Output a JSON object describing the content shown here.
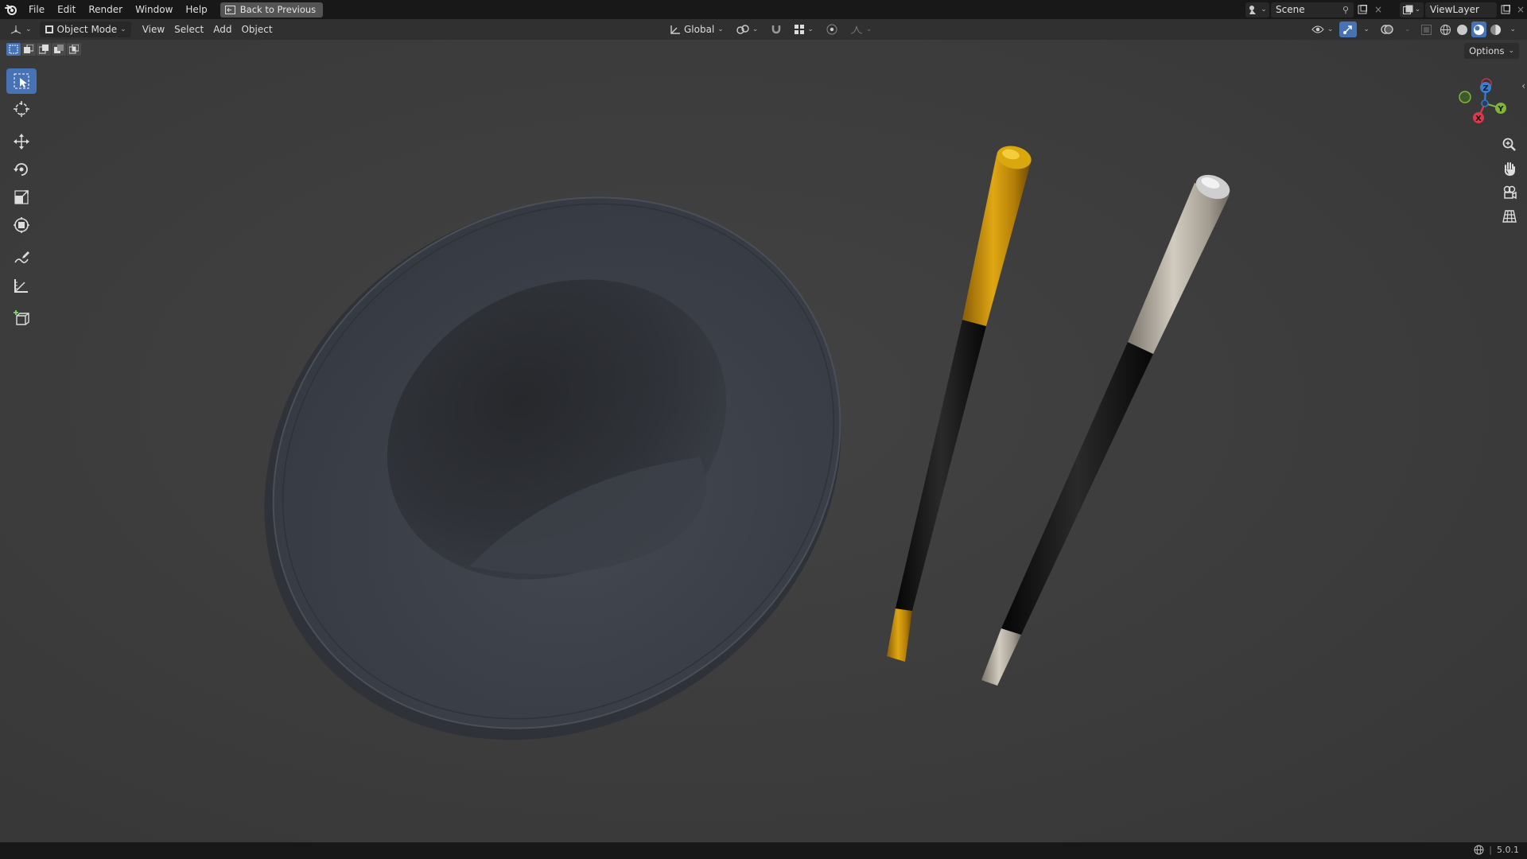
{
  "menubar": {
    "items": [
      "File",
      "Edit",
      "Render",
      "Window",
      "Help"
    ],
    "back_button": "Back to Previous",
    "scene_name": "Scene",
    "view_layer": "ViewLayer"
  },
  "header": {
    "mode": "Object Mode",
    "menus": [
      "View",
      "Select",
      "Add",
      "Object"
    ],
    "orientation": "Global"
  },
  "viewport": {
    "options_label": "Options",
    "gizmo_axes": {
      "x": "X",
      "y": "Y",
      "z": "Z"
    }
  },
  "toolbar": {
    "tools": [
      "select-box",
      "cursor",
      "move",
      "rotate",
      "scale",
      "transform",
      "annotate",
      "measure",
      "add-cube"
    ],
    "active_tool": "select-box"
  },
  "statusbar": {
    "version": "5.0.1"
  },
  "colors": {
    "accent": "#4772b3",
    "gold": "#c89210",
    "silver": "#b9b1a4",
    "hat": "#3b3f47"
  }
}
